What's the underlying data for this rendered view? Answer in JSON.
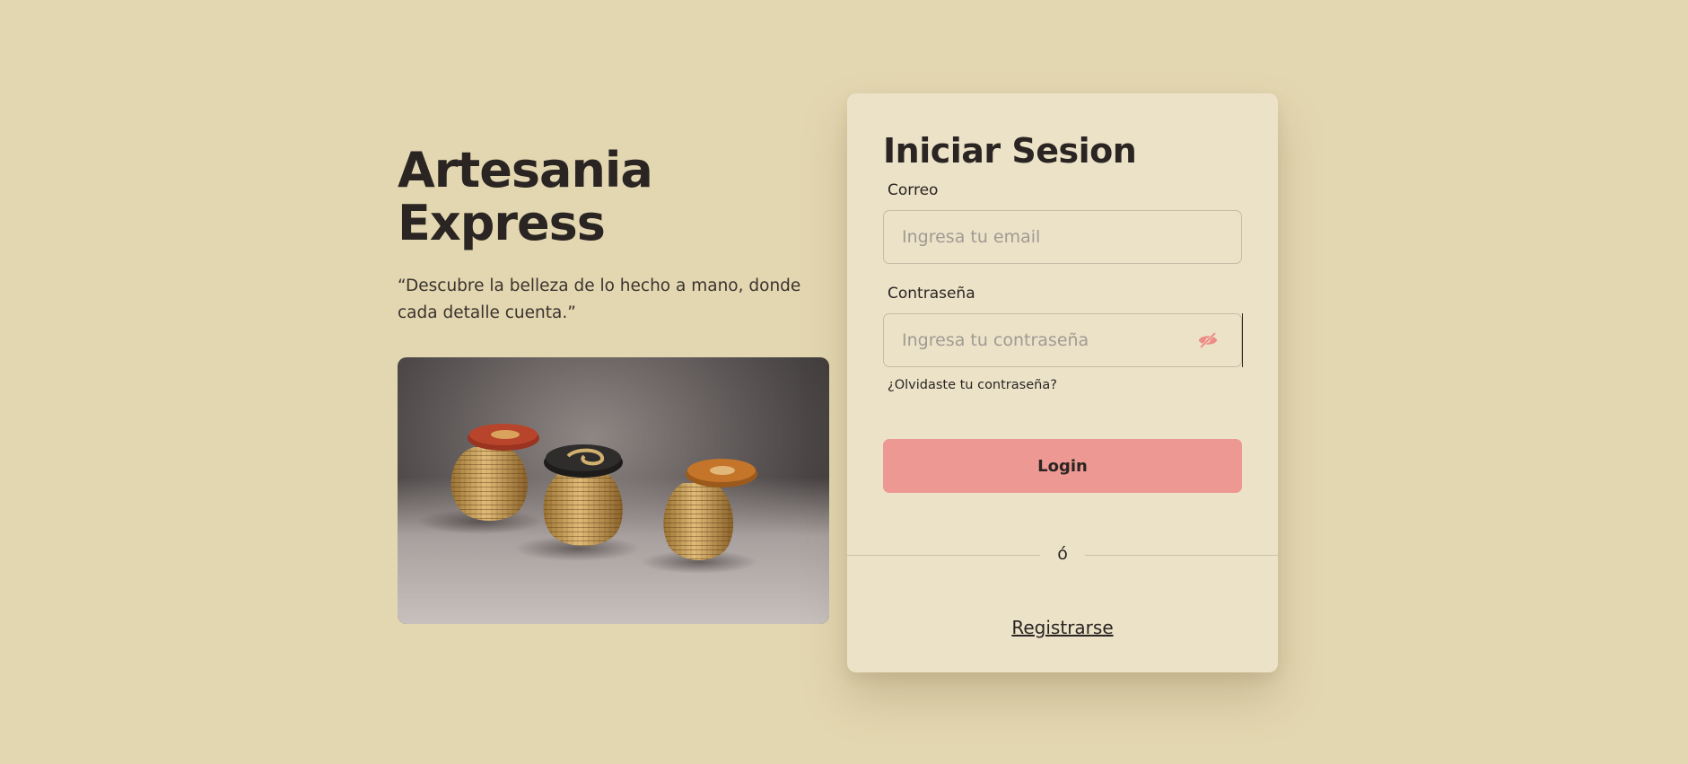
{
  "hero": {
    "title_line1": "Artesania",
    "title_line2": "Express",
    "quote": "“Descubre la belleza de lo hecho a mano, donde cada detalle cuenta.”",
    "image_alt": "Tres canastos tejidos artesanales con tapa"
  },
  "login": {
    "title": "Iniciar Sesion",
    "email_label": "Correo",
    "email_placeholder": "Ingresa tu email",
    "email_value": "",
    "password_label": "Contraseña",
    "password_placeholder": "Ingresa tu contraseña",
    "password_value": "",
    "toggle_icon": "eye-slash-icon",
    "forgot_link": "¿Olvidaste tu contraseña?",
    "submit_label": "Login",
    "divider_text": "ó",
    "register_link": "Registrarse"
  },
  "colors": {
    "background": "#e3d7b1",
    "card": "#ece2c8",
    "accent": "#ed9892",
    "text": "#2a2522"
  }
}
